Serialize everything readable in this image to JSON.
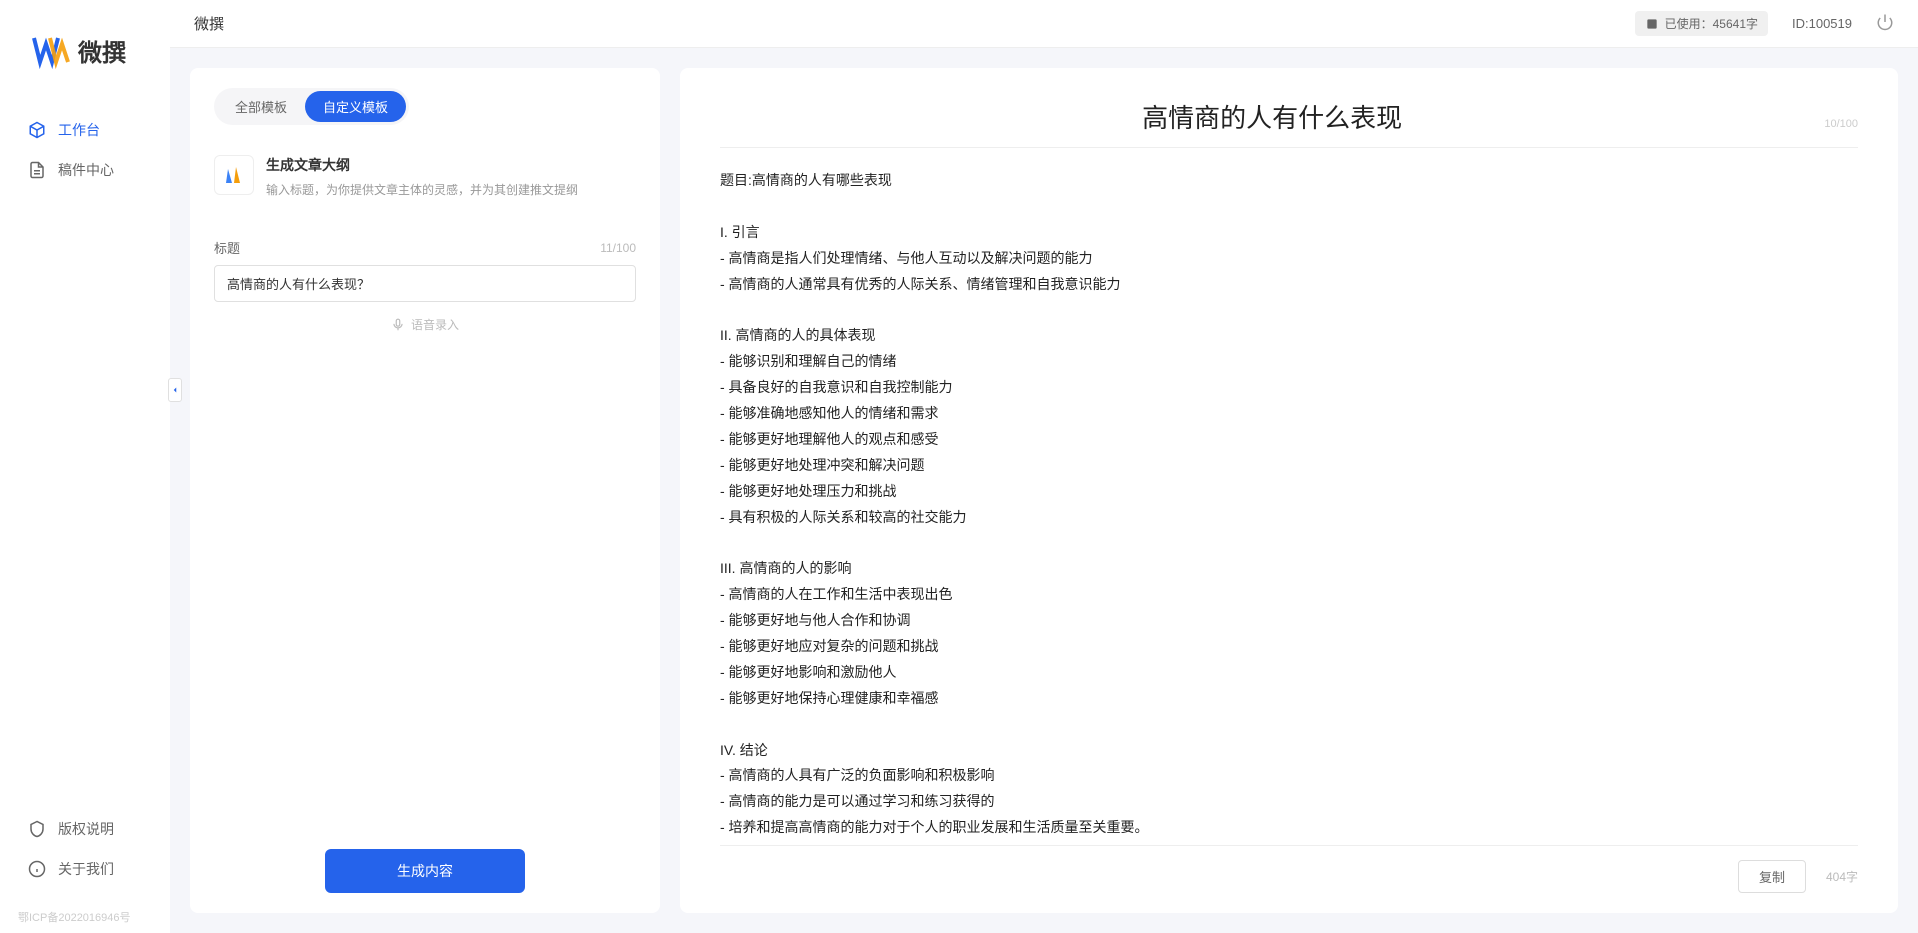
{
  "app": {
    "logo_text": "微撰",
    "topbar_title": "微撰",
    "usage_label": "已使用：45641字",
    "user_id": "ID:100519",
    "icp": "鄂ICP备2022016946号"
  },
  "sidebar": {
    "items": [
      {
        "label": "工作台",
        "active": true
      },
      {
        "label": "稿件中心",
        "active": false
      }
    ],
    "bottom_items": [
      {
        "label": "版权说明"
      },
      {
        "label": "关于我们"
      }
    ]
  },
  "left": {
    "tabs": [
      {
        "label": "全部模板",
        "active": false
      },
      {
        "label": "自定义模板",
        "active": true
      }
    ],
    "template": {
      "title": "生成文章大纲",
      "desc": "输入标题，为你提供文章主体的灵感，并为其创建推文提纲"
    },
    "field_label": "标题",
    "input_value": "高情商的人有什么表现？",
    "char_count": "11/100",
    "voice_label": "语音录入",
    "generate_label": "生成内容"
  },
  "right": {
    "title": "高情商的人有什么表现",
    "title_count": "10/100",
    "body": "题目:高情商的人有哪些表现\n\nI. 引言\n- 高情商是指人们处理情绪、与他人互动以及解决问题的能力\n- 高情商的人通常具有优秀的人际关系、情绪管理和自我意识能力\n\nII. 高情商的人的具体表现\n- 能够识别和理解自己的情绪\n- 具备良好的自我意识和自我控制能力\n- 能够准确地感知他人的情绪和需求\n- 能够更好地理解他人的观点和感受\n- 能够更好地处理冲突和解决问题\n- 能够更好地处理压力和挑战\n- 具有积极的人际关系和较高的社交能力\n\nIII. 高情商的人的影响\n- 高情商的人在工作和生活中表现出色\n- 能够更好地与他人合作和协调\n- 能够更好地应对复杂的问题和挑战\n- 能够更好地影响和激励他人\n- 能够更好地保持心理健康和幸福感\n\nIV. 结论\n- 高情商的人具有广泛的负面影响和积极影响\n- 高情商的能力是可以通过学习和练习获得的\n- 培养和提高高情商的能力对于个人的职业发展和生活质量至关重要。",
    "copy_label": "复制",
    "word_count": "404字"
  }
}
